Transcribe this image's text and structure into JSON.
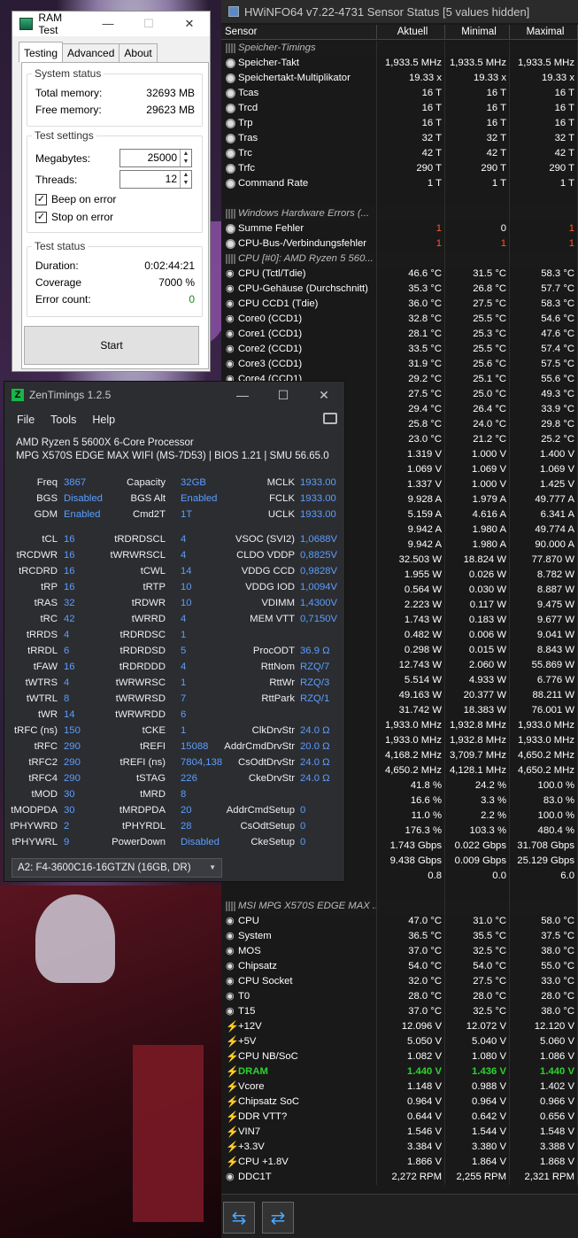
{
  "ramtest": {
    "title": "RAM Test",
    "tabs": [
      "Testing",
      "Advanced",
      "About"
    ],
    "system": {
      "title": "System status",
      "rows": [
        {
          "k": "Total memory:",
          "v": "32693 MB"
        },
        {
          "k": "Free memory:",
          "v": "29623 MB"
        }
      ]
    },
    "settings": {
      "title": "Test settings",
      "megabytes_label": "Megabytes:",
      "megabytes": "25000",
      "threads_label": "Threads:",
      "threads": "12",
      "beep": "Beep on error",
      "stop": "Stop on error"
    },
    "status": {
      "title": "Test status",
      "rows": [
        {
          "k": "Duration:",
          "v": "0:02:44:21"
        },
        {
          "k": "Coverage",
          "v": "7000 %"
        },
        {
          "k": "Error count:",
          "v": "0"
        }
      ]
    },
    "start": "Start"
  },
  "hwinfo": {
    "title": "HWiNFO64 v7.22-4731 Sensor Status [5 values hidden]",
    "headers": [
      "Sensor",
      "Aktuell",
      "Minimal",
      "Maximal"
    ],
    "rows": [
      {
        "t": "sec",
        "n": "Speicher-Timings"
      },
      {
        "i": "circ",
        "n": "Speicher-Takt",
        "a": "1,933.5 MHz",
        "b": "1,933.5 MHz",
        "c": "1,933.5 MHz"
      },
      {
        "i": "circ",
        "n": "Speichertakt-Multiplikator",
        "a": "19.33 x",
        "b": "19.33 x",
        "c": "19.33 x"
      },
      {
        "i": "circ",
        "n": "Tcas",
        "a": "16 T",
        "b": "16 T",
        "c": "16 T"
      },
      {
        "i": "circ",
        "n": "Trcd",
        "a": "16 T",
        "b": "16 T",
        "c": "16 T"
      },
      {
        "i": "circ",
        "n": "Trp",
        "a": "16 T",
        "b": "16 T",
        "c": "16 T"
      },
      {
        "i": "circ",
        "n": "Tras",
        "a": "32 T",
        "b": "32 T",
        "c": "32 T"
      },
      {
        "i": "circ",
        "n": "Trc",
        "a": "42 T",
        "b": "42 T",
        "c": "42 T"
      },
      {
        "i": "circ",
        "n": "Trfc",
        "a": "290 T",
        "b": "290 T",
        "c": "290 T"
      },
      {
        "i": "circ",
        "n": "Command Rate",
        "a": "1 T",
        "b": "1 T",
        "c": "1 T"
      },
      {
        "t": "blank"
      },
      {
        "t": "sec",
        "n": "Windows Hardware Errors (..."
      },
      {
        "i": "circ",
        "n": "Summe Fehler",
        "a": "1",
        "b": "0",
        "c": "1",
        "red": [
          1,
          0,
          1
        ]
      },
      {
        "i": "circ",
        "n": "CPU-Bus-/Verbindungsfehler",
        "a": "1",
        "b": "1",
        "c": "1",
        "red": [
          1,
          1,
          1
        ]
      },
      {
        "t": "sec",
        "n": "CPU [#0]: AMD Ryzen 5 560..."
      },
      {
        "i": "fan",
        "n": "CPU (Tctl/Tdie)",
        "a": "46.6 °C",
        "b": "31.5 °C",
        "c": "58.3 °C"
      },
      {
        "i": "fan",
        "n": "CPU-Gehäuse (Durchschnitt)",
        "a": "35.3 °C",
        "b": "26.8 °C",
        "c": "57.7 °C"
      },
      {
        "i": "fan",
        "n": "CPU CCD1 (Tdie)",
        "a": "36.0 °C",
        "b": "27.5 °C",
        "c": "58.3 °C"
      },
      {
        "i": "fan",
        "n": "Core0 (CCD1)",
        "a": "32.8 °C",
        "b": "25.5 °C",
        "c": "54.6 °C"
      },
      {
        "i": "fan",
        "n": "Core1 (CCD1)",
        "a": "28.1 °C",
        "b": "25.3 °C",
        "c": "47.6 °C"
      },
      {
        "i": "fan",
        "n": "Core2 (CCD1)",
        "a": "33.5 °C",
        "b": "25.5 °C",
        "c": "57.4 °C"
      },
      {
        "i": "fan",
        "n": "Core3 (CCD1)",
        "a": "31.9 °C",
        "b": "25.6 °C",
        "c": "57.5 °C"
      },
      {
        "i": "fan",
        "n": "Core4 (CCD1)",
        "a": "29.2 °C",
        "b": "25.1 °C",
        "c": "55.6 °C"
      },
      {
        "n": "",
        "a": "27.5 °C",
        "b": "25.0 °C",
        "c": "49.3 °C"
      },
      {
        "n": "",
        "a": "29.4 °C",
        "b": "26.4 °C",
        "c": "33.9 °C"
      },
      {
        "n": "",
        "a": "25.8 °C",
        "b": "24.0 °C",
        "c": "29.8 °C"
      },
      {
        "n": "",
        "a": "23.0 °C",
        "b": "21.2 °C",
        "c": "25.2 °C"
      },
      {
        "n": "2 TFN)",
        "a": "1.319 V",
        "b": "1.000 V",
        "c": "1.400 V"
      },
      {
        "n": "",
        "a": "1.069 V",
        "b": "1.069 V",
        "c": "1.069 V"
      },
      {
        "n": "",
        "a": "1.337 V",
        "b": "1.000 V",
        "c": "1.425 V"
      },
      {
        "n": "N)",
        "a": "9.928 A",
        "b": "1.979 A",
        "c": "49.777 A"
      },
      {
        "n": "",
        "a": "5.159 A",
        "b": "4.616 A",
        "c": "6.341 A"
      },
      {
        "n": "",
        "a": "9.942 A",
        "b": "1.980 A",
        "c": "49.774 A"
      },
      {
        "n": "",
        "a": "9.942 A",
        "b": "1.980 A",
        "c": "90.000 A"
      },
      {
        "n": "nahme",
        "a": "32.503 W",
        "b": "18.824 W",
        "c": "77.870 W"
      },
      {
        "n": "",
        "a": "1.955 W",
        "b": "0.026 W",
        "c": "8.782 W"
      },
      {
        "n": "",
        "a": "0.564 W",
        "b": "0.030 W",
        "c": "8.887 W"
      },
      {
        "n": "",
        "a": "2.223 W",
        "b": "0.117 W",
        "c": "9.475 W"
      },
      {
        "n": "",
        "a": "1.743 W",
        "b": "0.183 W",
        "c": "9.677 W"
      },
      {
        "n": "",
        "a": "0.482 W",
        "b": "0.006 W",
        "c": "9.041 W"
      },
      {
        "n": "",
        "a": "0.298 W",
        "b": "0.015 W",
        "c": "8.843 W"
      },
      {
        "n": "ahm...",
        "a": "12.743 W",
        "b": "2.060 W",
        "c": "55.869 W"
      },
      {
        "n": "hm...",
        "a": "5.514 W",
        "b": "4.933 W",
        "c": "6.776 W"
      },
      {
        "n": "uch...",
        "a": "49.163 W",
        "b": "20.377 W",
        "c": "88.211 W"
      },
      {
        "n": "",
        "a": "31.742 W",
        "b": "18.383 W",
        "c": "76.001 W"
      },
      {
        "n": "<)",
        "a": "1,933.0 MHz",
        "b": "1,932.8 MHz",
        "c": "1,933.0 MHz"
      },
      {
        "n": "oller...",
        "a": "1,933.0 MHz",
        "b": "1,932.8 MHz",
        "c": "1,933.0 MHz"
      },
      {
        "n": "",
        "a": "4,168.2 MHz",
        "b": "3,709.7 MHz",
        "c": "4,650.2 MHz"
      },
      {
        "n": "",
        "a": "4,650.2 MHz",
        "b": "4,128.1 MHz",
        "c": "4,650.2 MHz"
      },
      {
        "n": "",
        "a": "41.8 %",
        "b": "24.2 %",
        "c": "100.0 %"
      },
      {
        "n": "",
        "a": "16.6 %",
        "b": "3.3 %",
        "c": "83.0 %"
      },
      {
        "n": "",
        "a": "11.0 %",
        "b": "2.2 %",
        "c": "100.0 %"
      },
      {
        "n": "erbr...",
        "a": "176.3 %",
        "b": "103.3 %",
        "c": "480.4 %"
      },
      {
        "n": "",
        "a": "1.743 Gbps",
        "b": "0.022 Gbps",
        "c": "31.708 Gbps"
      },
      {
        "n": "",
        "a": "9.438 Gbps",
        "b": "0.009 Gbps",
        "c": "25.129 Gbps"
      },
      {
        "n": "akti...",
        "a": "0.8",
        "b": "0.0",
        "c": "6.0"
      },
      {
        "t": "blank"
      },
      {
        "t": "sec",
        "n": "MSI MPG X570S EDGE MAX ..."
      },
      {
        "i": "fan",
        "n": "CPU",
        "a": "47.0 °C",
        "b": "31.0 °C",
        "c": "58.0 °C"
      },
      {
        "i": "fan",
        "n": "System",
        "a": "36.5 °C",
        "b": "35.5 °C",
        "c": "37.5 °C"
      },
      {
        "i": "fan",
        "n": "MOS",
        "a": "37.0 °C",
        "b": "32.5 °C",
        "c": "38.0 °C"
      },
      {
        "i": "fan",
        "n": "Chipsatz",
        "a": "54.0 °C",
        "b": "54.0 °C",
        "c": "55.0 °C"
      },
      {
        "i": "fan",
        "n": "CPU Socket",
        "a": "32.0 °C",
        "b": "27.5 °C",
        "c": "33.0 °C"
      },
      {
        "i": "fan",
        "n": "T0",
        "a": "28.0 °C",
        "b": "28.0 °C",
        "c": "28.0 °C"
      },
      {
        "i": "fan",
        "n": "T15",
        "a": "37.0 °C",
        "b": "32.5 °C",
        "c": "38.0 °C"
      },
      {
        "i": "bolt",
        "n": "+12V",
        "a": "12.096 V",
        "b": "12.072 V",
        "c": "12.120 V"
      },
      {
        "i": "bolt",
        "n": "+5V",
        "a": "5.050 V",
        "b": "5.040 V",
        "c": "5.060 V"
      },
      {
        "i": "bolt",
        "n": "CPU NB/SoC",
        "a": "1.082 V",
        "b": "1.080 V",
        "c": "1.086 V"
      },
      {
        "i": "bolt",
        "n": "DRAM",
        "a": "1.440 V",
        "b": "1.436 V",
        "c": "1.440 V",
        "hl": true
      },
      {
        "i": "bolt",
        "n": "Vcore",
        "a": "1.148 V",
        "b": "0.988 V",
        "c": "1.402 V"
      },
      {
        "i": "bolt",
        "n": "Chipsatz SoC",
        "a": "0.964 V",
        "b": "0.964 V",
        "c": "0.966 V"
      },
      {
        "i": "bolt",
        "n": "DDR VTT?",
        "a": "0.644 V",
        "b": "0.642 V",
        "c": "0.656 V"
      },
      {
        "i": "bolt",
        "n": "VIN7",
        "a": "1.546 V",
        "b": "1.544 V",
        "c": "1.548 V"
      },
      {
        "i": "bolt",
        "n": "+3.3V",
        "a": "3.384 V",
        "b": "3.380 V",
        "c": "3.388 V"
      },
      {
        "i": "bolt",
        "n": "CPU +1.8V",
        "a": "1.866 V",
        "b": "1.864 V",
        "c": "1.868 V"
      },
      {
        "i": "fan",
        "n": "DDC1T",
        "a": "2,272 RPM",
        "b": "2,255 RPM",
        "c": "2,321 RPM"
      }
    ],
    "nav_left": "⇆",
    "nav_right": "⇄"
  },
  "zen": {
    "title": "ZenTimings 1.2.5",
    "menu": [
      "File",
      "Tools",
      "Help"
    ],
    "cpu": "AMD Ryzen 5 5600X 6-Core Processor",
    "board": "MPG X570S EDGE MAX WIFI (MS-7D53) | BIOS 1.21 | SMU 56.65.0",
    "top": [
      [
        "Freq",
        "3867",
        "Capacity",
        "32GB",
        "MCLK",
        "1933.00"
      ],
      [
        "BGS",
        "Disabled",
        "BGS Alt",
        "Enabled",
        "FCLK",
        "1933.00"
      ],
      [
        "GDM",
        "Enabled",
        "Cmd2T",
        "1T",
        "UCLK",
        "1933.00"
      ]
    ],
    "timings": [
      [
        "tCL",
        "16",
        "tRDRDSCL",
        "4",
        "VSOC (SVI2)",
        "1,0688V"
      ],
      [
        "tRCDWR",
        "16",
        "tWRWRSCL",
        "4",
        "CLDO VDDP",
        "0,8825V"
      ],
      [
        "tRCDRD",
        "16",
        "tCWL",
        "14",
        "VDDG CCD",
        "0,9828V"
      ],
      [
        "tRP",
        "16",
        "tRTP",
        "10",
        "VDDG IOD",
        "1,0094V"
      ],
      [
        "tRAS",
        "32",
        "tRDWR",
        "10",
        "VDIMM",
        "1,4300V"
      ],
      [
        "tRC",
        "42",
        "tWRRD",
        "4",
        "MEM VTT",
        "0,7150V"
      ],
      [
        "tRRDS",
        "4",
        "tRDRDSC",
        "1",
        "",
        ""
      ],
      [
        "tRRDL",
        "6",
        "tRDRDSD",
        "5",
        "ProcODT",
        "36.9 Ω"
      ],
      [
        "tFAW",
        "16",
        "tRDRDDD",
        "4",
        "RttNom",
        "RZQ/7"
      ],
      [
        "tWTRS",
        "4",
        "tWRWRSC",
        "1",
        "RttWr",
        "RZQ/3"
      ],
      [
        "tWTRL",
        "8",
        "tWRWRSD",
        "7",
        "RttPark",
        "RZQ/1"
      ],
      [
        "tWR",
        "14",
        "tWRWRDD",
        "6",
        "",
        ""
      ],
      [
        "tRFC (ns)",
        "150",
        "tCKE",
        "1",
        "ClkDrvStr",
        "24.0 Ω"
      ],
      [
        "tRFC",
        "290",
        "tREFI",
        "15088",
        "AddrCmdDrvStr",
        "20.0 Ω"
      ],
      [
        "tRFC2",
        "290",
        "tREFI (ns)",
        "7804,138",
        "CsOdtDrvStr",
        "24.0 Ω"
      ],
      [
        "tRFC4",
        "290",
        "tSTAG",
        "226",
        "CkeDrvStr",
        "24.0 Ω"
      ],
      [
        "tMOD",
        "30",
        "tMRD",
        "8",
        "",
        ""
      ],
      [
        "tMODPDA",
        "30",
        "tMRDPDA",
        "20",
        "AddrCmdSetup",
        "0"
      ],
      [
        "tPHYWRD",
        "2",
        "tPHYRDL",
        "28",
        "CsOdtSetup",
        "0"
      ],
      [
        "tPHYWRL",
        "9",
        "PowerDown",
        "Disabled",
        "CkeSetup",
        "0"
      ]
    ],
    "module": "A2: F4-3600C16-16GTZN (16GB, DR)"
  }
}
